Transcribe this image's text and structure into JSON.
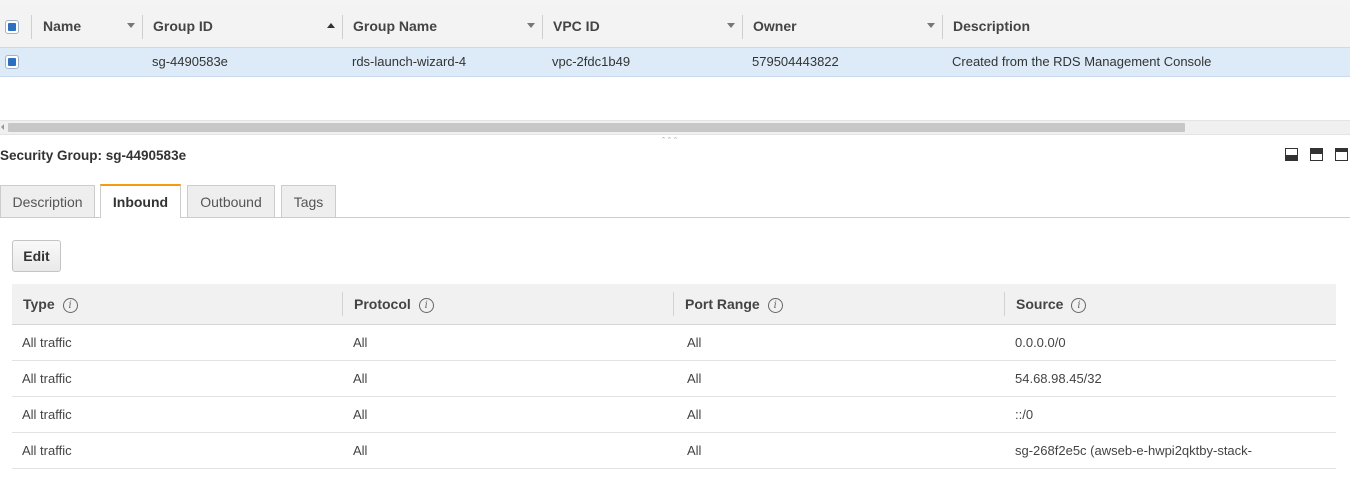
{
  "security_groups_table": {
    "columns": [
      "Name",
      "Group ID",
      "Group Name",
      "VPC ID",
      "Owner",
      "Description"
    ],
    "rows": [
      {
        "name": "",
        "group_id": "sg-4490583e",
        "group_name": "rds-launch-wizard-4",
        "vpc_id": "vpc-2fdc1b49",
        "owner": "579504443822",
        "description": "Created from the RDS Management Console",
        "selected": true
      }
    ]
  },
  "detail_pane": {
    "title": "Security Group: sg-4490583e",
    "tabs": [
      "Description",
      "Inbound",
      "Outbound",
      "Tags"
    ],
    "active_tab": "Inbound",
    "edit_label": "Edit",
    "inbound": {
      "columns": [
        "Type",
        "Protocol",
        "Port Range",
        "Source"
      ],
      "info_glyph": "i",
      "rows": [
        [
          "All traffic",
          "All",
          "All",
          "0.0.0.0/0"
        ],
        [
          "All traffic",
          "All",
          "All",
          "54.68.98.45/32"
        ],
        [
          "All traffic",
          "All",
          "All",
          "::/0"
        ],
        [
          "All traffic",
          "All",
          "All",
          "sg-268f2e5c (awseb-e-hwpi2qktby-stack-"
        ]
      ]
    }
  },
  "splitter_glyph": "ˆˆˆ",
  "colors": {
    "selected_row": "#ddebf8",
    "active_tab_accent": "#f39c12",
    "checkbox_fill": "#2d6fc0"
  }
}
